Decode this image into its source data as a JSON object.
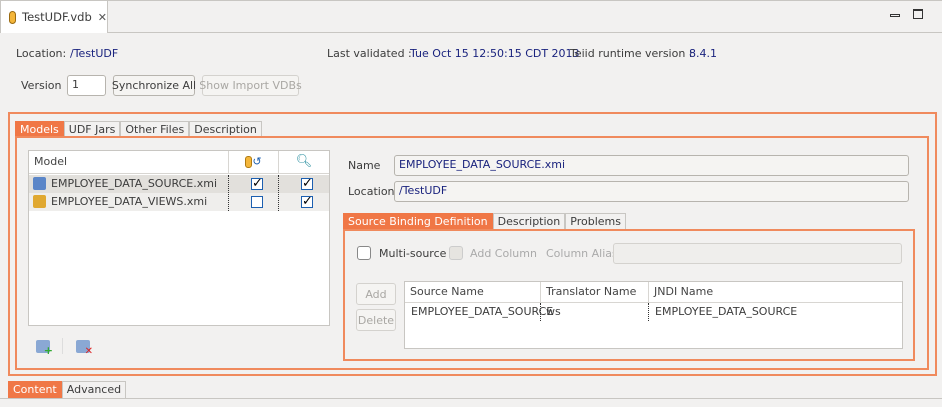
{
  "editor": {
    "tab_title": "TestUDF.vdb"
  },
  "header": {
    "location_label": "Location:",
    "location_value": "/TestUDF",
    "last_validated_label": "Last validated :",
    "last_validated_value": "Tue Oct 15 12:50:15 CDT 2013",
    "runtime_label": "Teiid runtime version :",
    "runtime_value": "8.4.1",
    "version_label": "Version",
    "version_value": "1",
    "synchronize_label": "Synchronize All",
    "show_import_label": "Show Import VDBs"
  },
  "main_tabs": [
    "Models",
    "UDF Jars",
    "Other Files",
    "Description"
  ],
  "models_table": {
    "columns": [
      "Model"
    ],
    "rows": [
      {
        "name": "EMPLOYEE_DATA_SOURCE.xmi",
        "col1": true,
        "col2": true,
        "icon": "source-model-icon"
      },
      {
        "name": "EMPLOYEE_DATA_VIEWS.xmi",
        "col1": false,
        "col2": true,
        "icon": "view-model-icon"
      }
    ]
  },
  "details": {
    "name_label": "Name",
    "name_value": "EMPLOYEE_DATA_SOURCE.xmi",
    "location_label": "Location",
    "location_value": "/TestUDF"
  },
  "sub_tabs": [
    "Source Binding Definition",
    "Description",
    "Problems"
  ],
  "binding": {
    "multi_source": "Multi-source",
    "add_column": "Add Column",
    "column_alias": "Column Alias",
    "add": "Add",
    "delete": "Delete",
    "columns": [
      "Source Name",
      "Translator Name",
      "JNDI Name"
    ],
    "rows": [
      [
        "EMPLOYEE_DATA_SOURCE",
        "ws",
        "EMPLOYEE_DATA_SOURCE"
      ]
    ]
  },
  "bottom_tabs": [
    "Content",
    "Advanced"
  ],
  "colors": {
    "accent": "#f07746",
    "link": "#1a237e"
  }
}
